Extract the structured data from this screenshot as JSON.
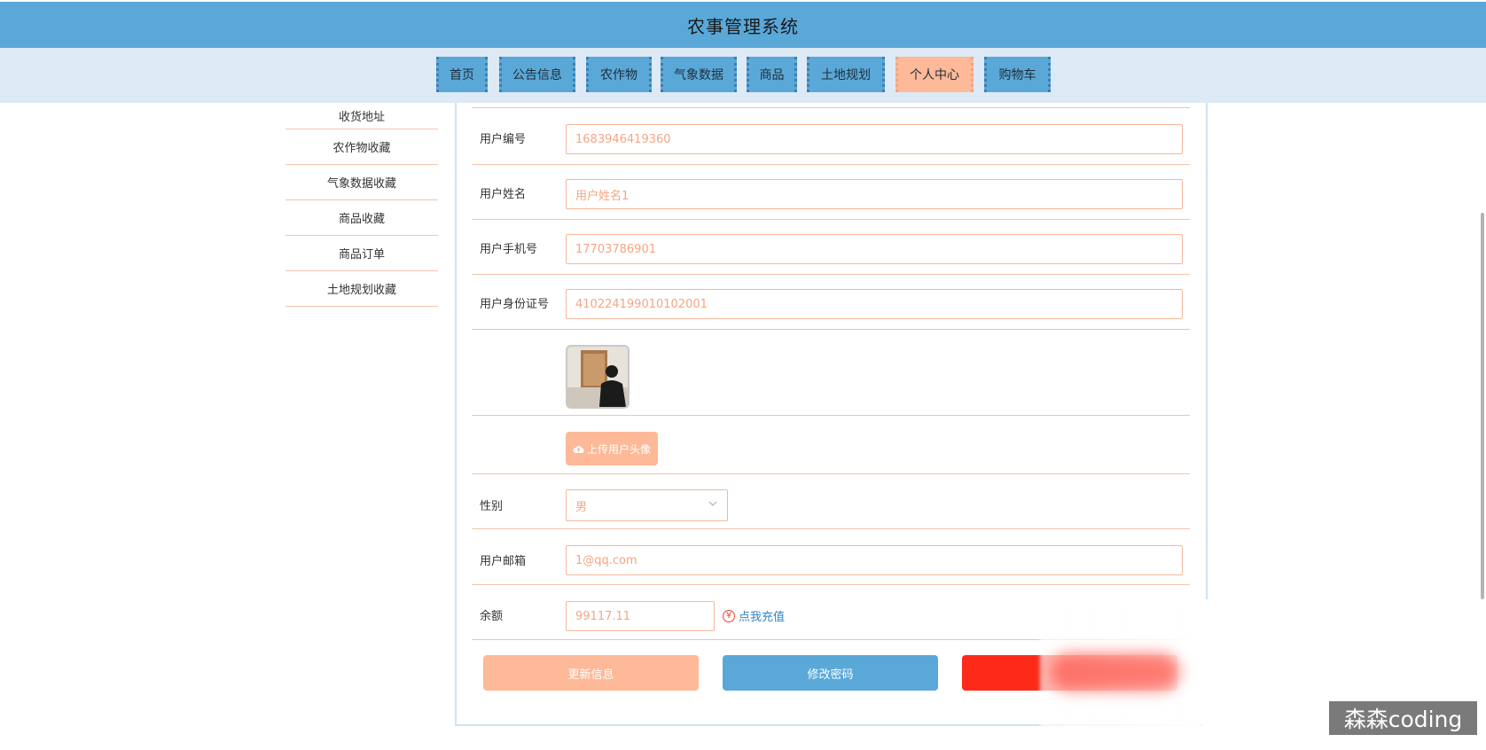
{
  "app": {
    "title": "农事管理系统"
  },
  "nav": {
    "items": [
      {
        "label": "首页"
      },
      {
        "label": "公告信息"
      },
      {
        "label": "农作物"
      },
      {
        "label": "气象数据"
      },
      {
        "label": "商品"
      },
      {
        "label": "土地规划"
      },
      {
        "label": "个人中心",
        "active": true
      },
      {
        "label": "购物车"
      }
    ]
  },
  "sidebar": {
    "items": [
      {
        "label": "收货地址"
      },
      {
        "label": "农作物收藏"
      },
      {
        "label": "气象数据收藏"
      },
      {
        "label": "商品收藏"
      },
      {
        "label": "商品订单"
      },
      {
        "label": "土地规划收藏"
      }
    ]
  },
  "form": {
    "user_no": {
      "label": "用户编号",
      "value": "1683946419360"
    },
    "user_name": {
      "label": "用户姓名",
      "value": "用户姓名1"
    },
    "phone": {
      "label": "用户手机号",
      "value": "17703786901"
    },
    "id_card": {
      "label": "用户身份证号",
      "value": "410224199010102001"
    },
    "upload_label": "上传用户头像",
    "gender": {
      "label": "性别",
      "value": "男"
    },
    "email": {
      "label": "用户邮箱",
      "value": "1@qq.com"
    },
    "balance": {
      "label": "余额",
      "value": "99117.11",
      "recharge": "点我充值"
    }
  },
  "buttons": {
    "update": "更新信息",
    "password": "修改密码"
  },
  "watermark": "森森coding",
  "colors": {
    "primary_blue": "#5aa8d8",
    "accent_peach": "#fdb998",
    "danger_red": "#fd2a1a"
  }
}
